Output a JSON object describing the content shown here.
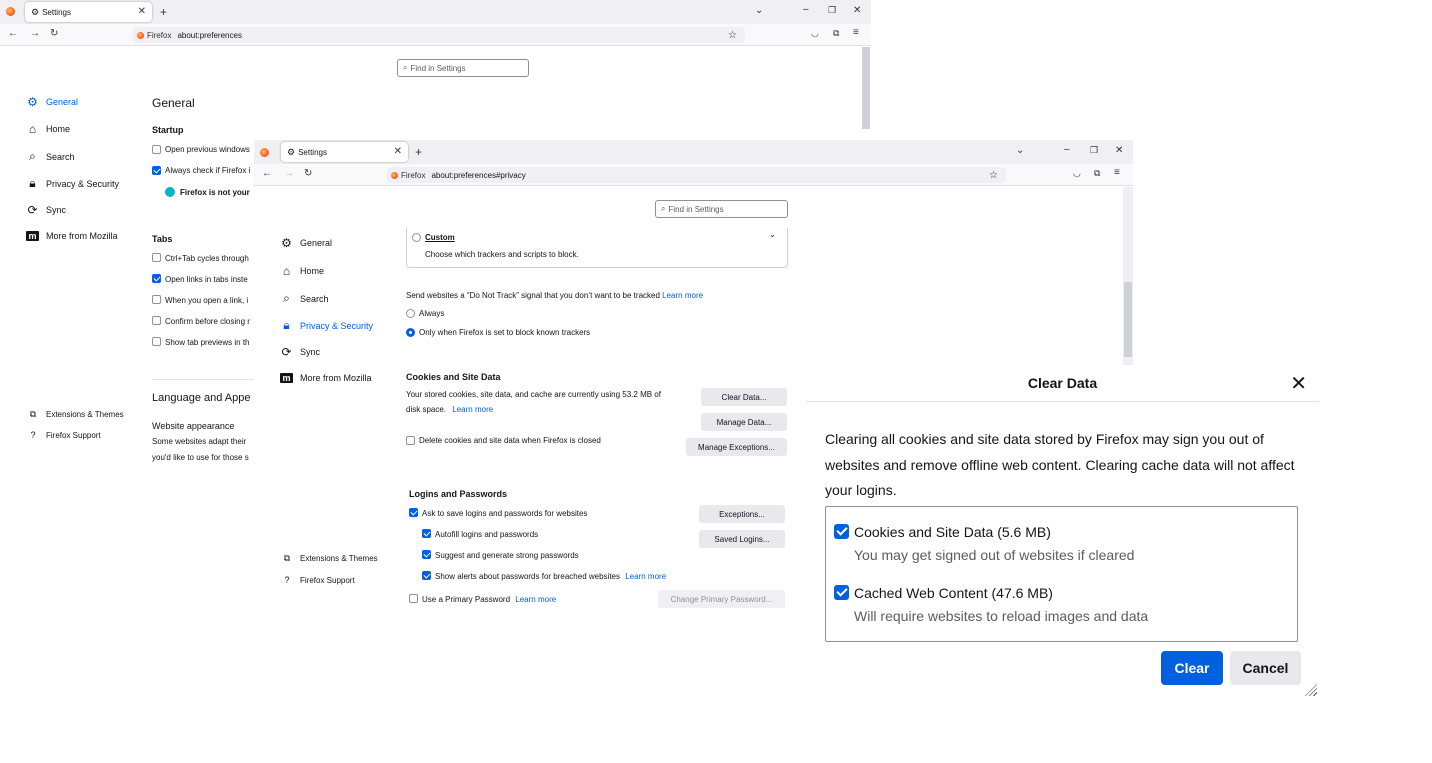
{
  "win1": {
    "tab_title": "Settings",
    "identity": "Firefox",
    "url": "about:preferences",
    "find_placeholder": "Find in Settings",
    "sidebar": [
      "General",
      "Home",
      "Search",
      "Privacy & Security",
      "Sync",
      "More from Mozilla"
    ],
    "sidebar_footer": [
      "Extensions & Themes",
      "Firefox Support"
    ],
    "page_title": "General",
    "startup_heading": "Startup",
    "startup_items": [
      "Open previous windows",
      "Always check if Firefox i"
    ],
    "default_notice": "Firefox is not your",
    "tabs_heading": "Tabs",
    "tabs_items": [
      "Ctrl+Tab cycles through",
      "Open links in tabs inste",
      "When you open a link, i",
      "Confirm before closing r",
      "Show tab previews in th"
    ],
    "lang_heading": "Language and Appe",
    "website_appearance": "Website appearance",
    "website_desc1": "Some websites adapt their",
    "website_desc2": "you'd like to use for those s"
  },
  "win2": {
    "tab_title": "Settings",
    "identity": "Firefox",
    "url": "about:preferences#privacy",
    "find_placeholder": "Find in Settings",
    "sidebar": [
      "General",
      "Home",
      "Search",
      "Privacy & Security",
      "Sync",
      "More from Mozilla"
    ],
    "sidebar_footer": [
      "Extensions & Themes",
      "Firefox Support"
    ],
    "custom_label": "Custom",
    "custom_desc": "Choose which trackers and scripts to block.",
    "dnt_text": "Send websites a “Do Not Track” signal that you don’t want to be tracked",
    "learn_more": "Learn more",
    "dnt_always": "Always",
    "dnt_only": "Only when Firefox is set to block known trackers",
    "cookies_heading": "Cookies and Site Data",
    "cookies_desc1": "Your stored cookies, site data, and cache are currently using 53.2 MB of",
    "cookies_desc2": "disk space.",
    "clear_data_btn": "Clear Data...",
    "manage_data_btn": "Manage Data...",
    "manage_exc_btn": "Manage Exceptions...",
    "delete_on_close": "Delete cookies and site data when Firefox is closed",
    "logins_heading": "Logins and Passwords",
    "ask_save": "Ask to save logins and passwords for websites",
    "autofill": "Autofill logins and passwords",
    "suggest": "Suggest and generate strong passwords",
    "alerts": "Show alerts about passwords for breached websites",
    "primary_pw": "Use a Primary Password",
    "exceptions_btn": "Exceptions...",
    "saved_logins_btn": "Saved Logins...",
    "change_primary_btn": "Change Primary Password..."
  },
  "dialog": {
    "title": "Clear Data",
    "description": "Clearing all cookies and site data stored by Firefox may sign you out of websites and remove offline web content. Clearing cache data will not affect your logins.",
    "opt1_label": "Cookies and Site Data (5.6 MB)",
    "opt1_sub": "You may get signed out of websites if cleared",
    "opt2_label": "Cached Web Content (47.6 MB)",
    "opt2_sub": "Will require websites to reload images and data",
    "clear_btn": "Clear",
    "cancel_btn": "Cancel"
  },
  "colors": {
    "accent": "#0061e0",
    "tabbar": "#f0f0f4",
    "button": "#e8e8ed"
  }
}
